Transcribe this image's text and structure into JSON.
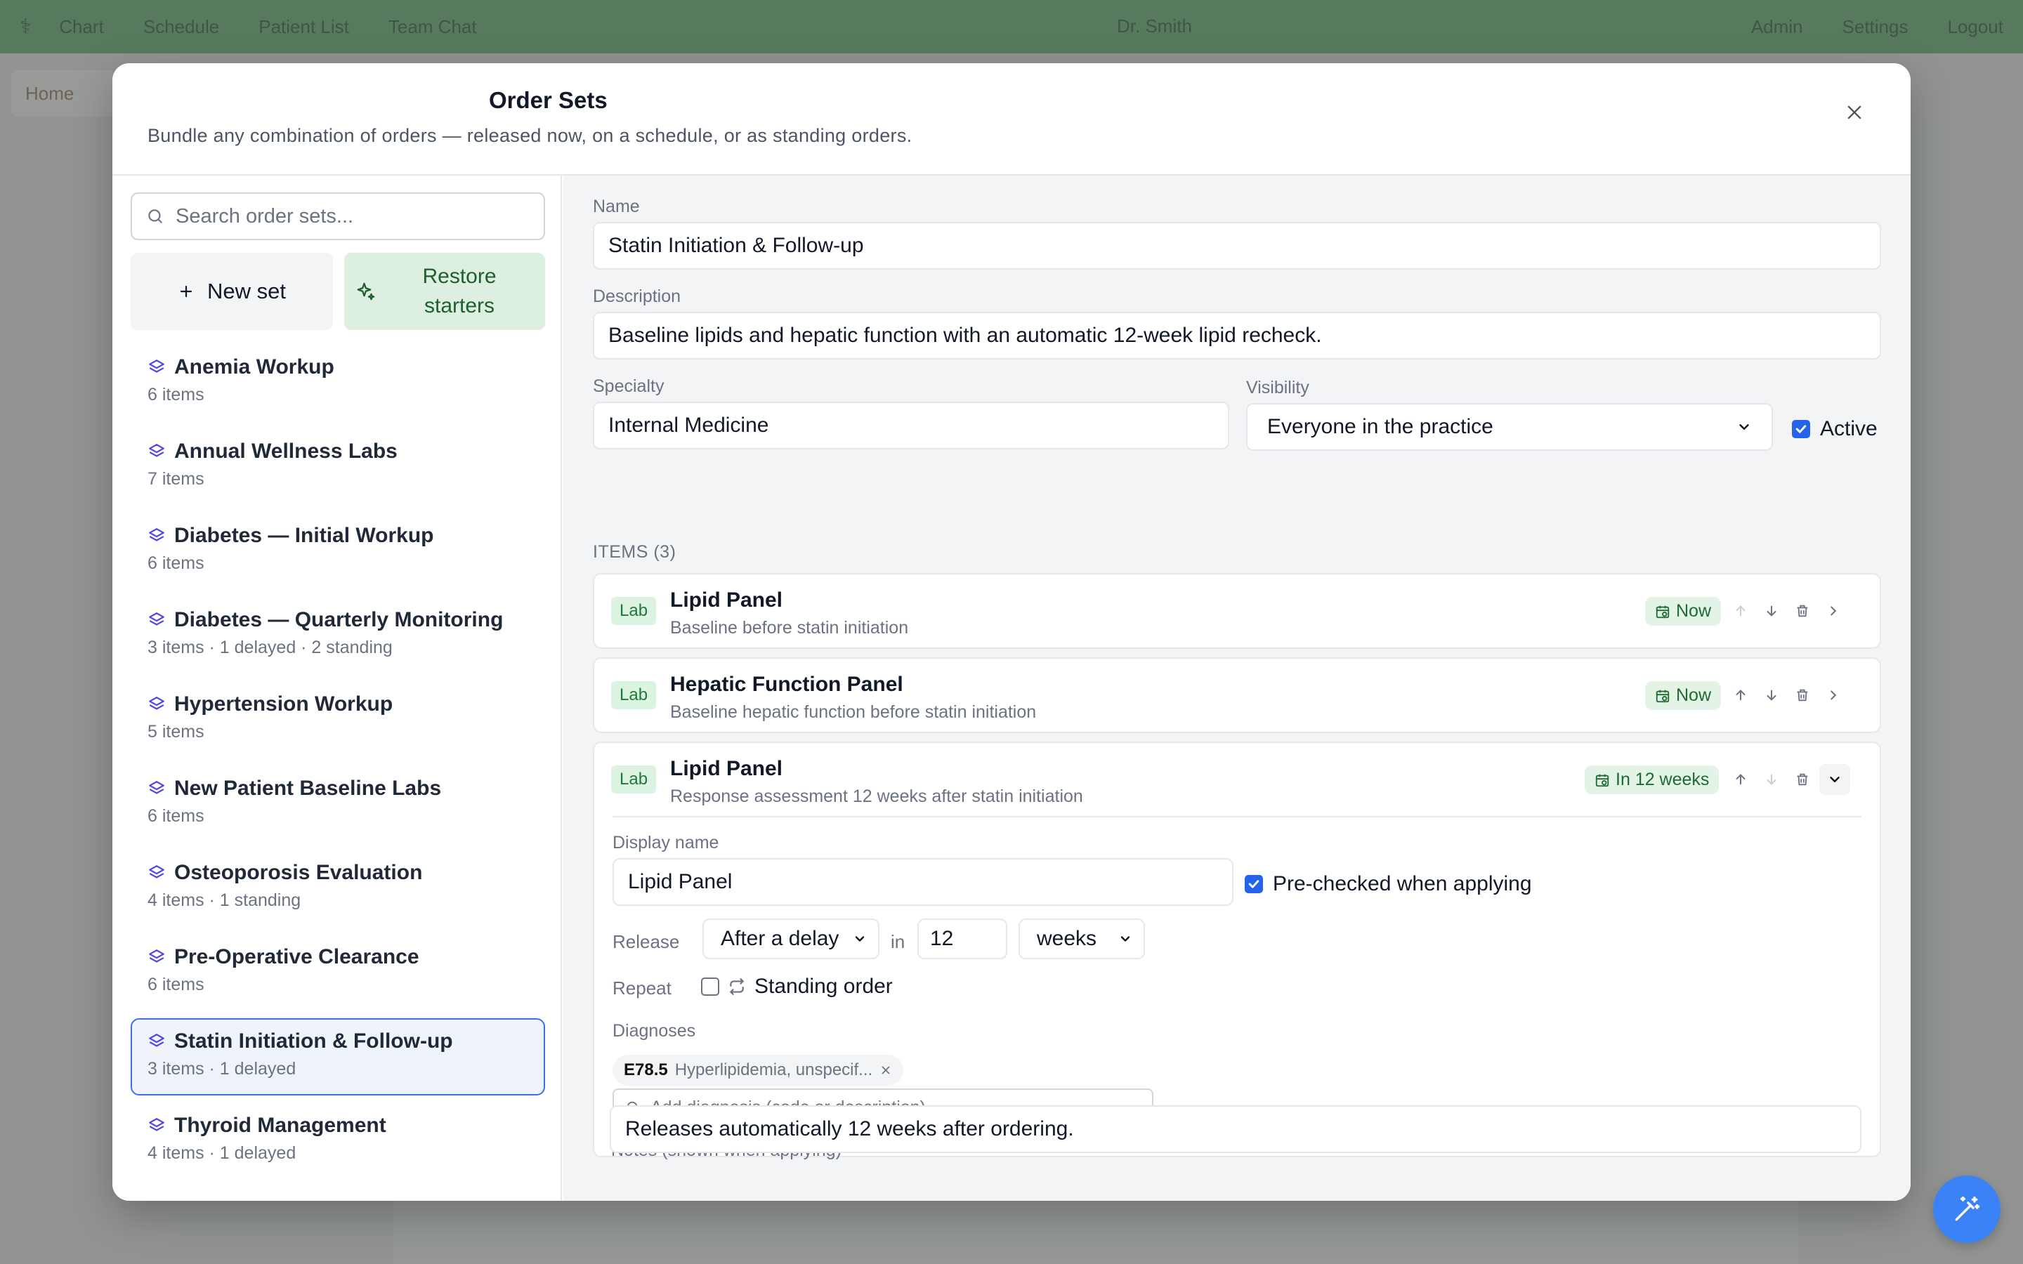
{
  "background": {
    "topbar": {
      "nav": [
        "Chart",
        "Schedule",
        "Patient List",
        "Team Chat"
      ],
      "center": "Dr. Smith",
      "right": [
        "Admin",
        "Settings",
        "Logout"
      ]
    },
    "tab_label": "Home"
  },
  "modal": {
    "title": "Order Sets",
    "subtitle": "Bundle any combination of orders — released now, on a schedule, or as standing orders."
  },
  "left": {
    "search_placeholder": "Search order sets...",
    "new_set_label": "New set",
    "restore_label": "Restore starters",
    "sets": [
      {
        "name": "Anemia Workup",
        "meta": "6 items"
      },
      {
        "name": "Annual Wellness Labs",
        "meta": "7 items"
      },
      {
        "name": "Diabetes — Initial Workup",
        "meta": "6 items"
      },
      {
        "name": "Diabetes — Quarterly Monitoring",
        "meta": "3 items · 1 delayed · 2 standing"
      },
      {
        "name": "Hypertension Workup",
        "meta": "5 items"
      },
      {
        "name": "New Patient Baseline Labs",
        "meta": "6 items"
      },
      {
        "name": "Osteoporosis Evaluation",
        "meta": "4 items · 1 standing"
      },
      {
        "name": "Pre-Operative Clearance",
        "meta": "6 items"
      },
      {
        "name": "Statin Initiation & Follow-up",
        "meta": "3 items · 1 delayed",
        "selected": true
      },
      {
        "name": "Thyroid Management",
        "meta": "4 items · 1 delayed"
      }
    ]
  },
  "editor": {
    "name_label": "Name",
    "name_value": "Statin Initiation & Follow-up",
    "description_label": "Description",
    "description_value": "Baseline lipids and hepatic function with an automatic 12-week lipid recheck.",
    "specialty_label": "Specialty",
    "specialty_value": "Internal Medicine",
    "visibility_label": "Visibility",
    "visibility_value": "Everyone in the practice",
    "active_label": "Active",
    "active_checked": true,
    "items_header": "ITEMS (3)",
    "items": [
      {
        "type": "Lab",
        "title": "Lipid Panel",
        "subtitle": "Baseline before statin initiation",
        "timing": "Now"
      },
      {
        "type": "Lab",
        "title": "Hepatic Function Panel",
        "subtitle": "Baseline hepatic function before statin initiation",
        "timing": "Now"
      },
      {
        "type": "Lab",
        "title": "Lipid Panel",
        "subtitle": "Response assessment 12 weeks after statin initiation",
        "timing": "In 12 weeks",
        "expanded": true
      }
    ],
    "expanded": {
      "display_name_label": "Display name",
      "display_name_value": "Lipid Panel",
      "prechecked_label": "Pre-checked when applying",
      "prechecked": true,
      "release_label": "Release",
      "release_value": "After a delay",
      "in_label": "in",
      "delay_amount": "12",
      "delay_unit": "weeks",
      "repeat_label": "Repeat",
      "standing_label": "Standing order",
      "standing_checked": false,
      "diagnoses_label": "Diagnoses",
      "diagnosis_code": "E78.5",
      "diagnosis_desc": "Hyperlipidemia, unspecif...",
      "add_diagnosis_placeholder": "Add diagnosis (code or description)...",
      "notes_label": "Notes (shown when applying)",
      "notes_value": "Releases automatically 12 weeks after ordering."
    }
  },
  "colors": {
    "accent": "#2563eb",
    "lab_badge_bg": "#dcf3e2",
    "timing_bg": "#e3f3e6",
    "selected_border": "#3b73d6",
    "layers_icon": "#4f46e5"
  }
}
